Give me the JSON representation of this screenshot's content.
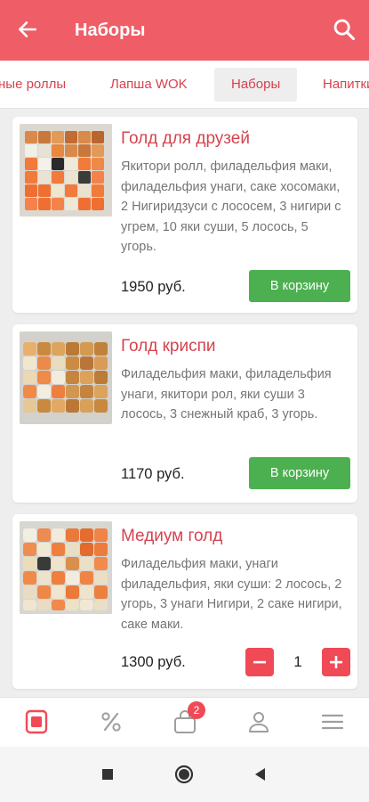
{
  "header": {
    "title": "Наборы"
  },
  "categories": [
    {
      "label": "ные роллы",
      "active": false
    },
    {
      "label": "Лапша WOK",
      "active": false
    },
    {
      "label": "Наборы",
      "active": true
    },
    {
      "label": "Напитки",
      "active": false
    }
  ],
  "products": [
    {
      "name": "Голд для друзей",
      "description": "Якитори ролл, филадельфия маки, филадельфия унаги, саке хосомаки, 2 Нигиридзуси с лососем, 3 нигири с угрем, 10 яки суши, 5 лосось, 5 угорь.",
      "price": "1950 руб.",
      "button": "В корзину"
    },
    {
      "name": "Голд криспи",
      "description": "Филадельфия маки, филадельфия унаги, якитори рол, яки суши 3 лосось, 3 снежный краб, 3 угорь.",
      "price": "1170 руб.",
      "button": "В корзину"
    },
    {
      "name": "Медиум голд",
      "description": "Филадельфия маки, унаги филадельфия, яки суши: 2 лосось, 2 угорь, 3 унаги Нигири, 2 саке нигири, саке маки.",
      "price": "1300 руб.",
      "quantity": "1"
    }
  ],
  "bottom_nav": {
    "items": [
      "menu-icon",
      "discount-icon",
      "cart-icon",
      "profile-icon",
      "hamburger-icon"
    ],
    "cart_badge": "2"
  },
  "colors": {
    "brand": "#ef5d67",
    "accent_text": "#d5434f",
    "buy_button": "#4caf50",
    "stepper": "#ef4a56"
  }
}
